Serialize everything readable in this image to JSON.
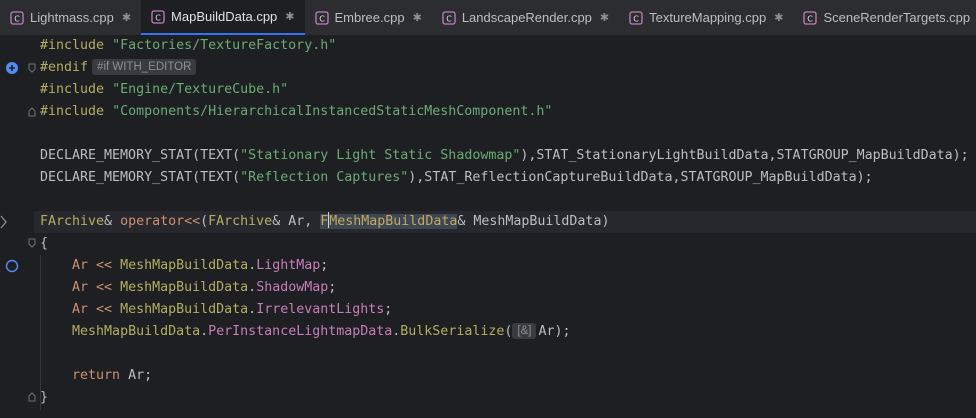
{
  "tabs": [
    {
      "label": "Lightmass.cpp",
      "active": false
    },
    {
      "label": "MapBuildData.cpp",
      "active": true
    },
    {
      "label": "Embree.cpp",
      "active": false
    },
    {
      "label": "LandscapeRender.cpp",
      "active": false
    },
    {
      "label": "TextureMapping.cpp",
      "active": false
    },
    {
      "label": "SceneRenderTargets.cpp",
      "active": false
    }
  ],
  "pin_glyph": "✱",
  "code": {
    "l1": {
      "kw": "#include",
      "str": "\"Factories/TextureFactory.h\""
    },
    "l2": {
      "kw": "#endif",
      "hint": "#if WITH_EDITOR"
    },
    "l3": {
      "kw": "#include",
      "str": "\"Engine/TextureCube.h\""
    },
    "l4": {
      "kw": "#include",
      "str": "\"Components/HierarchicalInstancedStaticMeshComponent.h\""
    },
    "l6": {
      "macro": "DECLARE_MEMORY_STAT",
      "open": "(",
      "text_macro": "TEXT",
      "str": "\"Stationary Light Static Shadowmap\"",
      "rest": "),STAT_StationaryLightBuildData,STATGROUP_MapBuildData);"
    },
    "l7": {
      "macro": "DECLARE_MEMORY_STAT",
      "open": "(",
      "text_macro": "TEXT",
      "str": "\"Reflection Captures\"",
      "rest": "),STAT_ReflectionCaptureBuildData,STATGROUP_MapBuildData);"
    },
    "l9": {
      "type1": "FArchive",
      "amp1": "& ",
      "op": "operator<<",
      "paren": "(",
      "type2": "FArchive",
      "amp2": "& ",
      "param1": "Ar",
      "comma": ", ",
      "type3a": "F",
      "type3b": "MeshMapBuildData",
      "amp3": "& ",
      "param2": "MeshMapBuildData",
      "close": ")"
    },
    "l10": {
      "brace": "{"
    },
    "l11": {
      "ar": "Ar",
      "op": " << ",
      "obj": "MeshMapBuildData",
      "dot": ".",
      "field": "LightMap",
      "end": ";"
    },
    "l12": {
      "ar": "Ar",
      "op": " << ",
      "obj": "MeshMapBuildData",
      "dot": ".",
      "field": "ShadowMap",
      "end": ";"
    },
    "l13": {
      "ar": "Ar",
      "op": " << ",
      "obj": "MeshMapBuildData",
      "dot": ".",
      "field": "IrrelevantLights",
      "end": ";"
    },
    "l14": {
      "obj": "MeshMapBuildData",
      "dot": ".",
      "field": "PerInstanceLightmapData",
      "dot2": ".",
      "fn": "BulkSerialize",
      "open": "(",
      "hint": "[&]",
      "arg": "Ar",
      "close": ");"
    },
    "l16": {
      "kw": "return",
      "arg": " Ar",
      "end": ";"
    },
    "l17": {
      "brace": "}"
    }
  }
}
